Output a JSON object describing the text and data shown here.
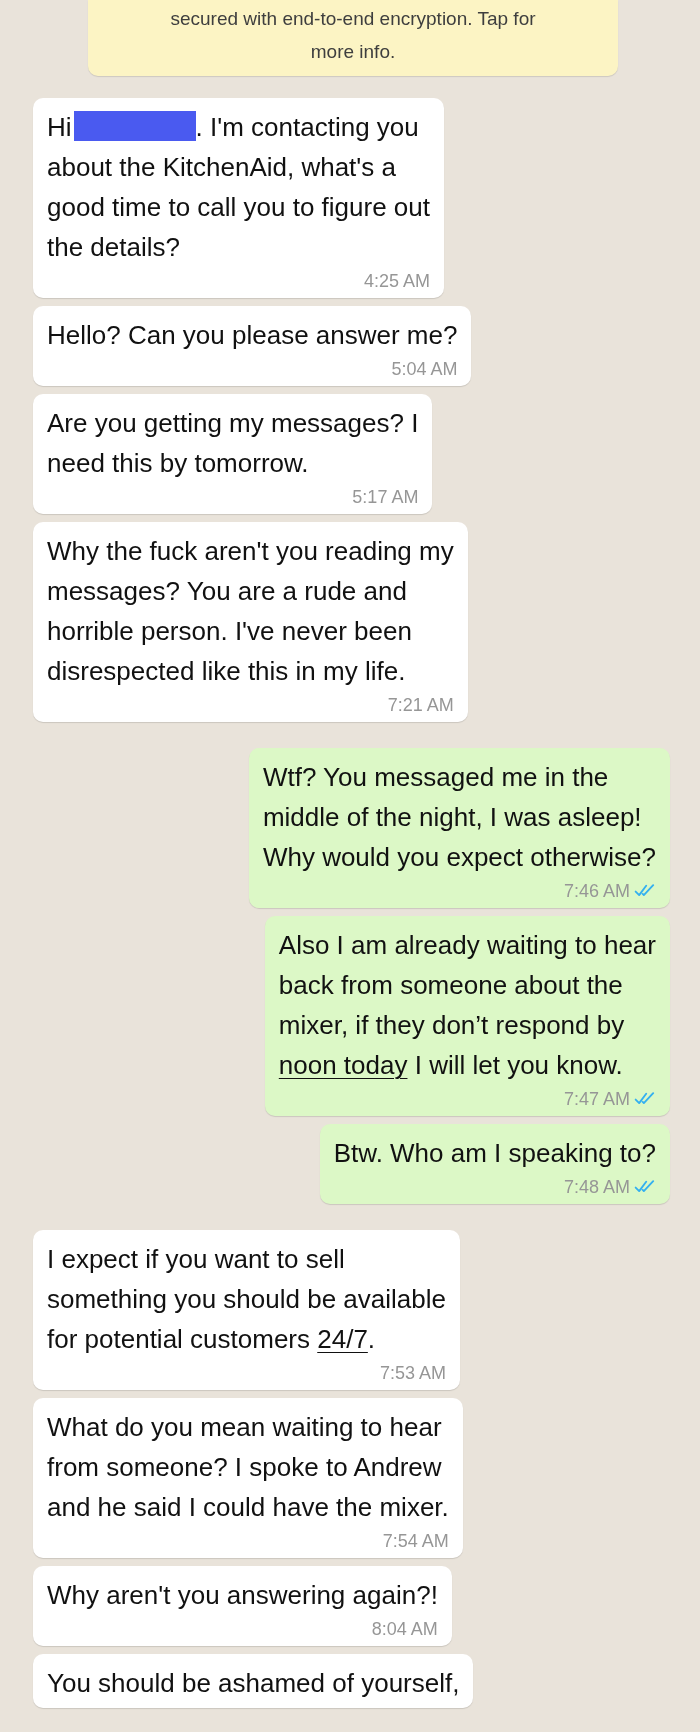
{
  "notice": {
    "text": "secured with end-to-end encryption. Tap for\nmore info."
  },
  "messages": [
    {
      "kind": "incoming",
      "parts": [
        {
          "kind": "text",
          "text": "Hi"
        },
        {
          "kind": "redacted"
        },
        {
          "kind": "text",
          "text": ". I'm contacting you\nabout the KitchenAid, what's a\ngood time to call you to figure out\nthe details?"
        }
      ],
      "time": "4:25 AM"
    },
    {
      "kind": "incoming",
      "parts": [
        {
          "kind": "text",
          "text": "Hello? Can you please answer me?"
        }
      ],
      "time": "5:04 AM"
    },
    {
      "kind": "incoming",
      "parts": [
        {
          "kind": "text",
          "text": "Are you getting my messages? I\nneed this by tomorrow."
        }
      ],
      "time": "5:17 AM"
    },
    {
      "kind": "incoming",
      "parts": [
        {
          "kind": "text",
          "text": "Why the fuck aren't you reading my\nmessages? You are a rude and\nhorrible person. I've never been\ndisrespected like this in my life."
        }
      ],
      "time": "7:21 AM"
    },
    {
      "kind": "outgoing",
      "parts": [
        {
          "kind": "text",
          "text": "Wtf? You messaged me in the\nmiddle of the night, I was asleep!\nWhy would you expect otherwise?"
        }
      ],
      "time": "7:46 AM",
      "read": true
    },
    {
      "kind": "outgoing",
      "parts": [
        {
          "kind": "text",
          "text": "Also I am already waiting to hear\nback from someone about the\nmixer, if they don’t respond by\n"
        },
        {
          "kind": "link",
          "text": "noon today"
        },
        {
          "kind": "text",
          "text": " I will let you know."
        }
      ],
      "time": "7:47 AM",
      "read": true
    },
    {
      "kind": "outgoing",
      "parts": [
        {
          "kind": "text",
          "text": "Btw. Who am I speaking to?"
        }
      ],
      "time": "7:48 AM",
      "read": true
    },
    {
      "kind": "incoming",
      "parts": [
        {
          "kind": "text",
          "text": "I expect if you want to sell\nsomething you should be available\nfor potential customers "
        },
        {
          "kind": "link",
          "text": "24/7"
        },
        {
          "kind": "text",
          "text": "."
        }
      ],
      "time": "7:53 AM"
    },
    {
      "kind": "incoming",
      "parts": [
        {
          "kind": "text",
          "text": "What do you mean waiting to hear\nfrom someone? I spoke to Andrew\nand he said I could have the mixer."
        }
      ],
      "time": "7:54 AM"
    },
    {
      "kind": "incoming",
      "parts": [
        {
          "kind": "text",
          "text": "Why aren't you answering again?!"
        }
      ],
      "time": "8:04 AM"
    },
    {
      "kind": "incoming",
      "parts": [
        {
          "kind": "text",
          "text": "You should be ashamed of yourself,"
        }
      ]
    }
  ]
}
